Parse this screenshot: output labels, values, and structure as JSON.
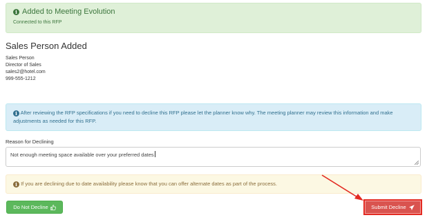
{
  "success_alert": {
    "title": "Added to Meeting Evolution",
    "subtitle": "Connected to this RFP"
  },
  "sales_person": {
    "heading": "Sales Person Added",
    "name": "Sales Person",
    "role": "Director of Sales",
    "email": "sales2@hotel.com",
    "phone": "999-555-1212"
  },
  "info_alert": {
    "text": "After reviewing the RFP specifications if you need to decline this RFP please let the planner know why. The meeting planner may review this information and make adjustments as needed for this RFP."
  },
  "decline_form": {
    "label": "Reason for Declining",
    "value": "Not enough meeting space available over your preferred dates"
  },
  "warning_alert": {
    "text": "If you are declining due to date availability please know that you can offer alternate dates as part of the process."
  },
  "buttons": {
    "do_not_decline": "Do Not Decline",
    "submit_decline": "Submit Decline"
  },
  "colors": {
    "success_bg": "#dff0d8",
    "info_bg": "#d9edf7",
    "warning_bg": "#fcf8e3",
    "green_button": "#5cb85c",
    "red_button": "#d9534f",
    "annotation": "#e32a22"
  },
  "icons": {
    "success": "info-circle-icon",
    "info": "info-circle-icon",
    "warning": "info-circle-icon",
    "do_not_decline": "thumbs-up-icon",
    "submit_decline": "paper-plane-icon"
  }
}
